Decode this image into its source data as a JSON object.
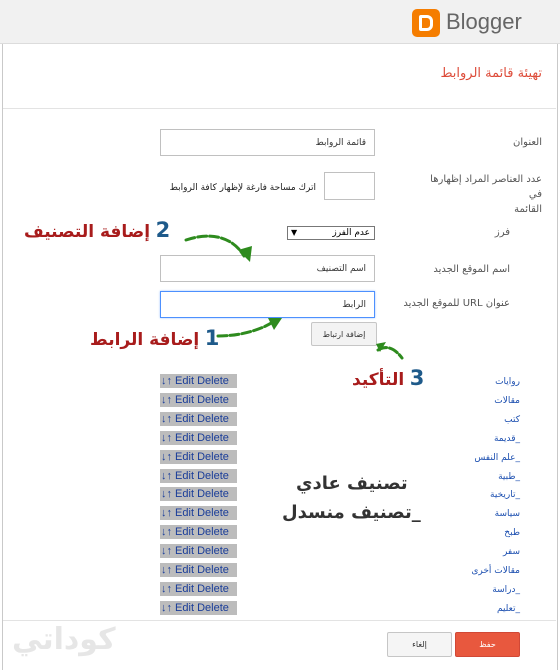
{
  "header": {
    "brand": "Blogger"
  },
  "page_title": "تهيئة قائمة الروابط",
  "form": {
    "title_label": "العنوان",
    "title_value": "قائمة الروابط",
    "count_label_line1": "عدد العناصر المراد إظهارها في",
    "count_label_line2": "القائمة",
    "count_hint_line1": "اترك مساحة فارغة لإظهار كافة الروابط",
    "count_value": "",
    "sort_label": "فرز",
    "sort_value": "عدم الفرز",
    "site_name_label": "اسم الموقع الجديد",
    "site_name_value": "اسم التصنيف",
    "site_url_label": "عنوان URL للموقع الجديد",
    "site_url_value": "الرابط",
    "add_link_button": "إضافة ارتباط"
  },
  "annotations": {
    "step2_num": "2",
    "step2_text": "إضافة التصنيف",
    "step1_num": "1",
    "step1_text": "إضافة الرابط",
    "step3_num": "3",
    "step3_text": "التأكيد",
    "normal_category": "تصنيف عادي",
    "nested_category": "_تصنيف منسدل"
  },
  "link_rows": [
    {
      "tools": "↓↑ Edit Delete",
      "label": "روايات"
    },
    {
      "tools": "↓↑ Edit Delete",
      "label": "مقالات"
    },
    {
      "tools": "↓↑ Edit Delete",
      "label": "كتب"
    },
    {
      "tools": "↓↑ Edit Delete",
      "label": "_قديمة"
    },
    {
      "tools": "↓↑ Edit Delete",
      "label": "_علم النفس"
    },
    {
      "tools": "↓↑ Edit Delete",
      "label": "_طبية"
    },
    {
      "tools": "↓↑ Edit Delete",
      "label": "_تاريخية"
    },
    {
      "tools": "↓↑ Edit Delete",
      "label": "سياسة"
    },
    {
      "tools": "↓↑ Edit Delete",
      "label": "طبخ"
    },
    {
      "tools": "↓↑ Edit Delete",
      "label": "سفر"
    },
    {
      "tools": "↓↑ Edit Delete",
      "label": "مقالات أخرى"
    },
    {
      "tools": "↓↑ Edit Delete",
      "label": "_دراسة"
    },
    {
      "tools": "↓↑ Edit Delete",
      "label": "_تعليم"
    }
  ],
  "footer": {
    "save_button": "حفظ",
    "cancel_button": "إلغاء"
  },
  "watermark": "كوداتي",
  "colors": {
    "accent": "#dd4b39",
    "brand": "#f57d00",
    "arrow": "#2e8b1e",
    "step_num": "#1e5a8a",
    "step_text": "#a81c1c"
  }
}
